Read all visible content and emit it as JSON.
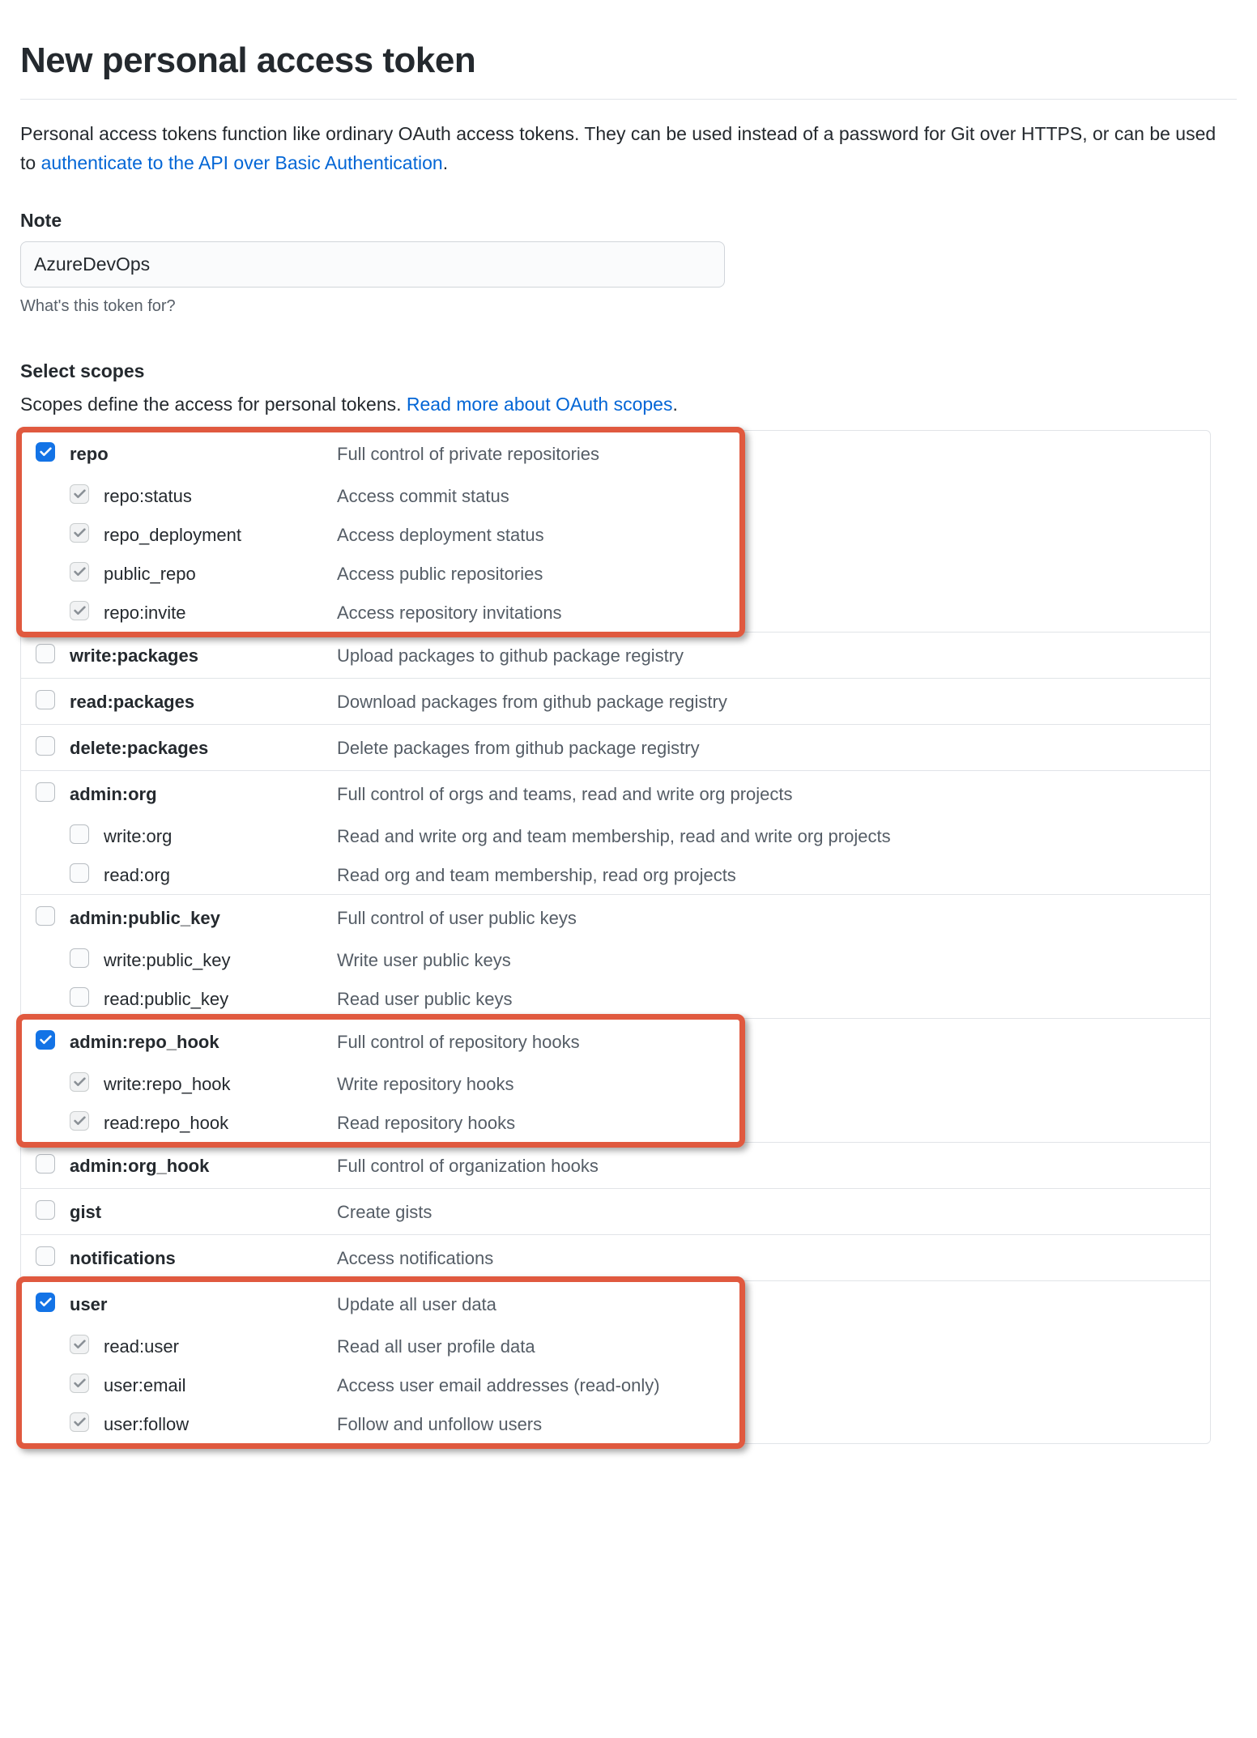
{
  "title": "New personal access token",
  "intro_before": "Personal access tokens function like ordinary OAuth access tokens. They can be used instead of a password for Git over HTTPS, or can be used to ",
  "intro_link": "authenticate to the API over Basic Authentication",
  "intro_after": ".",
  "note": {
    "label": "Note",
    "value": "AzureDevOps",
    "hint": "What's this token for?"
  },
  "scopes_heading": "Select scopes",
  "scopes_sub_before": "Scopes define the access for personal tokens. ",
  "scopes_sub_link": "Read more about OAuth scopes",
  "scopes_sub_after": ".",
  "groups": [
    {
      "name": "repo",
      "desc": "Full control of private repositories",
      "checked": true,
      "highlight": true,
      "children": [
        {
          "name": "repo:status",
          "desc": "Access commit status",
          "checked": true,
          "inherited": true
        },
        {
          "name": "repo_deployment",
          "desc": "Access deployment status",
          "checked": true,
          "inherited": true
        },
        {
          "name": "public_repo",
          "desc": "Access public repositories",
          "checked": true,
          "inherited": true
        },
        {
          "name": "repo:invite",
          "desc": "Access repository invitations",
          "checked": true,
          "inherited": true
        }
      ]
    },
    {
      "name": "write:packages",
      "desc": "Upload packages to github package registry",
      "checked": false,
      "children": []
    },
    {
      "name": "read:packages",
      "desc": "Download packages from github package registry",
      "checked": false,
      "children": []
    },
    {
      "name": "delete:packages",
      "desc": "Delete packages from github package registry",
      "checked": false,
      "children": []
    },
    {
      "name": "admin:org",
      "desc": "Full control of orgs and teams, read and write org projects",
      "checked": false,
      "children": [
        {
          "name": "write:org",
          "desc": "Read and write org and team membership, read and write org projects",
          "checked": false
        },
        {
          "name": "read:org",
          "desc": "Read org and team membership, read org projects",
          "checked": false
        }
      ]
    },
    {
      "name": "admin:public_key",
      "desc": "Full control of user public keys",
      "checked": false,
      "children": [
        {
          "name": "write:public_key",
          "desc": "Write user public keys",
          "checked": false
        },
        {
          "name": "read:public_key",
          "desc": "Read user public keys",
          "checked": false
        }
      ]
    },
    {
      "name": "admin:repo_hook",
      "desc": "Full control of repository hooks",
      "checked": true,
      "highlight": true,
      "children": [
        {
          "name": "write:repo_hook",
          "desc": "Write repository hooks",
          "checked": true,
          "inherited": true
        },
        {
          "name": "read:repo_hook",
          "desc": "Read repository hooks",
          "checked": true,
          "inherited": true
        }
      ]
    },
    {
      "name": "admin:org_hook",
      "desc": "Full control of organization hooks",
      "checked": false,
      "children": []
    },
    {
      "name": "gist",
      "desc": "Create gists",
      "checked": false,
      "children": []
    },
    {
      "name": "notifications",
      "desc": "Access notifications",
      "checked": false,
      "children": []
    },
    {
      "name": "user",
      "desc": "Update all user data",
      "checked": true,
      "highlight": true,
      "children": [
        {
          "name": "read:user",
          "desc": "Read all user profile data",
          "checked": true,
          "inherited": true
        },
        {
          "name": "user:email",
          "desc": "Access user email addresses (read-only)",
          "checked": true,
          "inherited": true
        },
        {
          "name": "user:follow",
          "desc": "Follow and unfollow users",
          "checked": true,
          "inherited": true
        }
      ]
    }
  ]
}
